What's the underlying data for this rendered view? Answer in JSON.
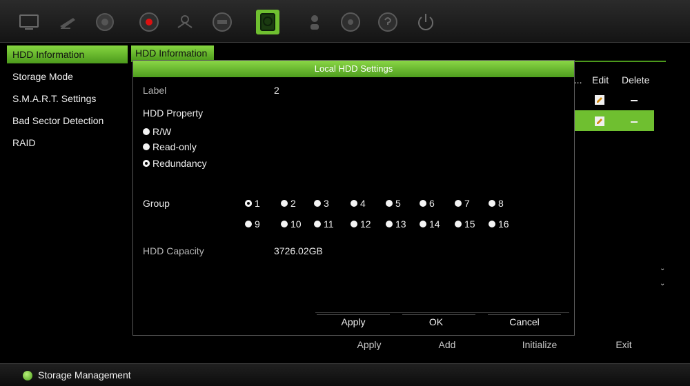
{
  "toolbar": {
    "icons": [
      "monitor-icon",
      "camera-icon",
      "network-icon",
      "record-icon",
      "alarm-icon",
      "device-icon",
      "hdd-icon",
      "user-icon",
      "system-icon",
      "help-icon",
      "power-icon"
    ],
    "active_icon": "hdd-icon",
    "accent": "#6fbf30"
  },
  "sidebar": {
    "items": [
      {
        "label": "HDD Information"
      },
      {
        "label": "Storage Mode"
      },
      {
        "label": "S.M.A.R.T. Settings"
      },
      {
        "label": "Bad Sector Detection"
      },
      {
        "label": "RAID"
      }
    ]
  },
  "main": {
    "title": "HDD Information",
    "columns": {
      "pro": "o...",
      "edit": "Edit",
      "delete": "Delete"
    },
    "bottom_buttons": {
      "apply": "Apply",
      "add": "Add",
      "initialize": "Initialize",
      "exit": "Exit"
    }
  },
  "modal": {
    "title": "Local HDD Settings",
    "label_caption": "Label",
    "label_value": "2",
    "property_caption": "HDD Property",
    "property_options": [
      "R/W",
      "Read-only",
      "Redundancy"
    ],
    "property_selected": "Redundancy",
    "group_caption": "Group",
    "groups": [
      "1",
      "2",
      "3",
      "4",
      "5",
      "6",
      "7",
      "8",
      "9",
      "10",
      "11",
      "12",
      "13",
      "14",
      "15",
      "16"
    ],
    "group_selected": "1",
    "capacity_caption": "HDD Capacity",
    "capacity_value": "3726.02GB",
    "buttons": {
      "apply": "Apply",
      "ok": "OK",
      "cancel": "Cancel"
    }
  },
  "status": {
    "text": "Storage Management",
    "dot_color": "#6fbf30"
  }
}
